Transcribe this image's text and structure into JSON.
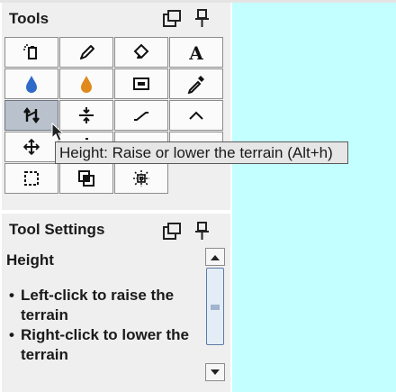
{
  "colors": {
    "viewport_background": "#c4ffff",
    "panel_background": "#efefef",
    "active_tool_background": "#b9c1cc",
    "tooltip_background": "#e6e6e6"
  },
  "tools_panel": {
    "title": "Tools",
    "header_icons": [
      "undock-icon",
      "pin-icon"
    ],
    "selected_tool": "height-tool",
    "tool_rows": [
      [
        "paste-tool",
        "pencil-tool",
        "fill-tool",
        "text-tool"
      ],
      [
        "water-tool",
        "lava-tool",
        "stamp-tool",
        "eyedropper-tool"
      ],
      [
        "height-tool",
        "flatten-tool",
        "ramp-tool",
        "peak-tool"
      ],
      [
        "move-tool",
        "partially-hidden-tool",
        "partially-hidden-tool",
        "partially-hidden-tool"
      ],
      [
        "rectangle-select-tool",
        "clone-selection-tool",
        "object-tool"
      ]
    ],
    "tooltip": "Height: Raise or lower the terrain (Alt+h)"
  },
  "settings_panel": {
    "title": "Tool Settings",
    "header_icons": [
      "undock-icon",
      "pin-icon"
    ],
    "heading": "Height",
    "bullets": [
      "Left-click to raise the terrain",
      "Right-click to lower the terrain"
    ]
  }
}
